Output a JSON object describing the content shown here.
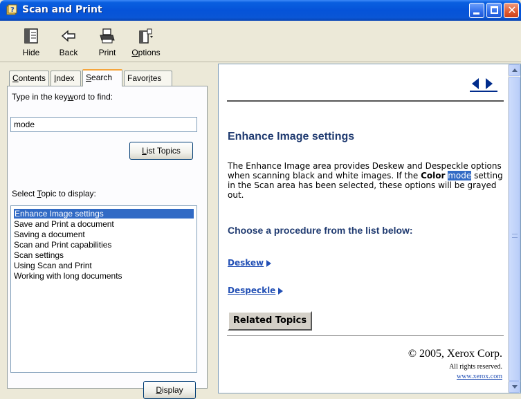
{
  "window": {
    "title": "Scan and Print"
  },
  "toolbar": {
    "hide": {
      "pre": "",
      "u": "",
      "post": "Hide",
      "icon": "hide-icon"
    },
    "back": {
      "pre": "",
      "u": "",
      "post": "Back",
      "icon": "back-arrow-icon"
    },
    "print": {
      "pre": "",
      "u": "",
      "post": "Print",
      "icon": "printer-icon"
    },
    "options": {
      "pre": "",
      "u": "O",
      "post": "ptions",
      "icon": "options-icon"
    }
  },
  "tabs": {
    "contents": {
      "u": "C",
      "post": "ontents"
    },
    "index": {
      "u": "I",
      "post": "ndex"
    },
    "search": {
      "pre": "",
      "u": "S",
      "post": "earch"
    },
    "favorites": {
      "pre": "Favor",
      "u": "i",
      "post": "tes"
    },
    "active": "search"
  },
  "search": {
    "keyword_label_pre": "Type in the key",
    "keyword_label_u": "w",
    "keyword_label_post": "ord to find:",
    "keyword_value": "mode",
    "list_topics_u": "L",
    "list_topics_post": "ist Topics",
    "select_label_pre": "Select ",
    "select_label_u": "T",
    "select_label_post": "opic to display:",
    "topics": [
      "Enhance Image settings",
      "Save and Print a document",
      "Saving a document",
      "Scan and Print capabilities",
      "Scan settings",
      "Using Scan and Print",
      "Working with long documents"
    ],
    "selected_topic": "Enhance Image settings",
    "display_u": "D",
    "display_post": "isplay"
  },
  "content": {
    "heading": "Enhance Image settings",
    "para_1": "The Enhance Image area provides Deskew and Despeckle options when scanning black and white images. If the ",
    "para_bold": "Color",
    "para_space": " ",
    "para_highlight": "mode",
    "para_2": " setting in the Scan area has been selected, these options will be grayed out.",
    "subheading": "Choose a procedure from the list below:",
    "links": [
      "Deskew",
      "Despeckle"
    ],
    "related_topics": "Related Topics",
    "copyright": "© 2005, Xerox Corp.",
    "rights": "All rights reserved.",
    "website": "www.xerox.com"
  },
  "colors": {
    "titlebar": "#0553d8",
    "selection": "#316ac5",
    "heading": "#1f3a70",
    "link": "#2350b5"
  }
}
